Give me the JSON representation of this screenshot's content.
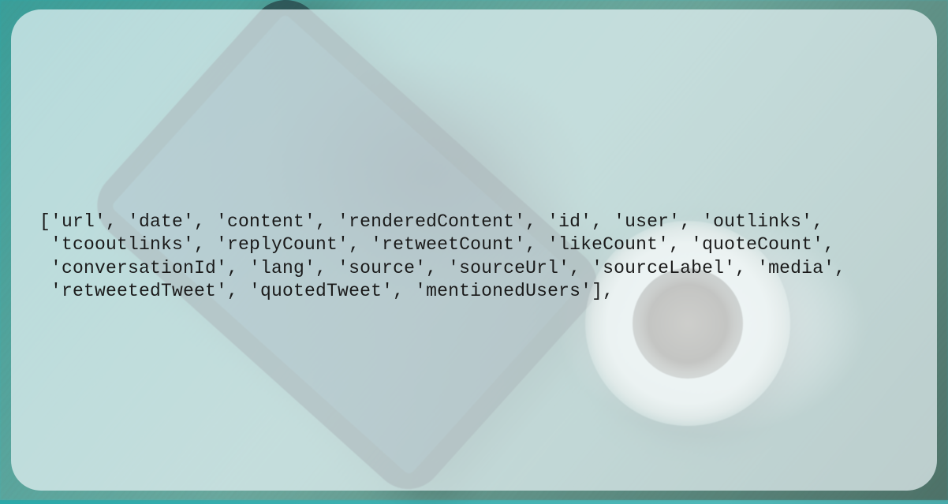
{
  "code": {
    "line1": "['url', 'date', 'content', 'renderedContent', 'id', 'user', 'outlinks',",
    "line2": " 'tcooutlinks', 'replyCount', 'retweetCount', 'likeCount', 'quoteCount',",
    "line3": " 'conversationId', 'lang', 'source', 'sourceUrl', 'sourceLabel', 'media',",
    "line4": " 'retweetedTweet', 'quotedTweet', 'mentionedUsers'],"
  }
}
